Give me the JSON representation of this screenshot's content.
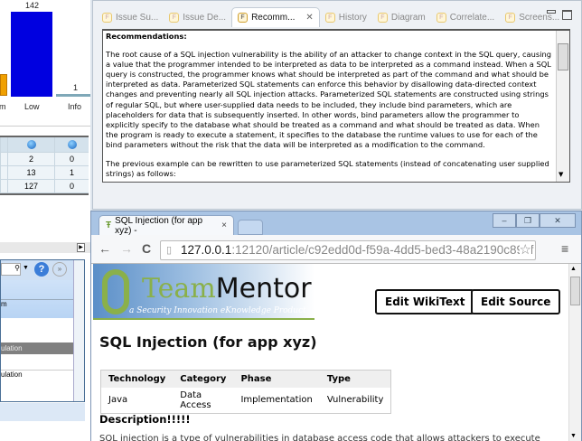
{
  "left_panel": {
    "chart": {
      "bars": [
        {
          "label": "m",
          "value": null
        },
        {
          "label": "Low",
          "value": 142
        },
        {
          "label": "Info",
          "value": 1
        }
      ],
      "colors": {
        "medium": "#f0a000",
        "low": "#0000e0",
        "info": "#7fa8b8"
      }
    },
    "table": {
      "header_icons": [
        "info-icon",
        "info-icon"
      ],
      "rows": [
        [
          "2",
          "0"
        ],
        [
          "13",
          "1"
        ],
        [
          "127",
          "0"
        ]
      ]
    },
    "list": {
      "column": "m",
      "items": [
        "",
        "",
        "ulation",
        "",
        "ulation"
      ]
    }
  },
  "editor": {
    "tabs": [
      {
        "label": "Issue Su..."
      },
      {
        "label": "Issue De..."
      },
      {
        "label": "Recomm..."
      },
      {
        "label": "History"
      },
      {
        "label": "Diagram"
      },
      {
        "label": "Correlate..."
      },
      {
        "label": "Screens..."
      }
    ],
    "heading": "Recommendations:",
    "paragraphs": [
      "The root cause of a SQL injection vulnerability is the ability of an attacker to change context in the SQL query, causing a value that the programmer intended to be interpreted as data to be interpreted as a command instead. When a SQL query is constructed, the programmer knows what should be interpreted as part of the command and what should be interpreted as data. Parameterized SQL statements can enforce this behavior by disallowing data-directed context changes and preventing nearly all SQL injection attacks. Parameterized SQL statements are constructed using strings of regular SQL, but where user-supplied data needs to be included, they include bind parameters, which are placeholders for data that is subsequently inserted. In other words, bind parameters allow the programmer to explicitly specify to the database what should be treated as a command and what should be treated as data. When the program is ready to execute a statement, it specifies to the database the runtime values to use for each of the bind parameters without the risk that the data will be interpreted as a modification to the command.",
      "The previous example can be rewritten to use parameterized SQL statements (instead of concatenating user supplied strings) as follows:"
    ]
  },
  "browser": {
    "tab_title": "SQL Injection (for app xyz) -",
    "url_host": "127.0.0.1",
    "url_rest": ":12120/article/c92edd0d-f59a-4dd5-bed3-48a2190c895f",
    "page": {
      "logo_text": "TeamMentor",
      "logo_sub": "a Security Innovation eKnowledge Product",
      "edit_wikitext": "Edit WikiText",
      "edit_source": "Edit Source",
      "title": "SQL Injection (for app xyz)",
      "meta_headers": [
        "Technology",
        "Category",
        "Phase",
        "Type"
      ],
      "meta_values": [
        "Java",
        "Data Access",
        "Implementation",
        "Vulnerability"
      ],
      "description_heading": "Description!!!!!",
      "description_start": "SQL injection is a type of vulnerabilities in database access code that allows attackers to execute"
    }
  }
}
